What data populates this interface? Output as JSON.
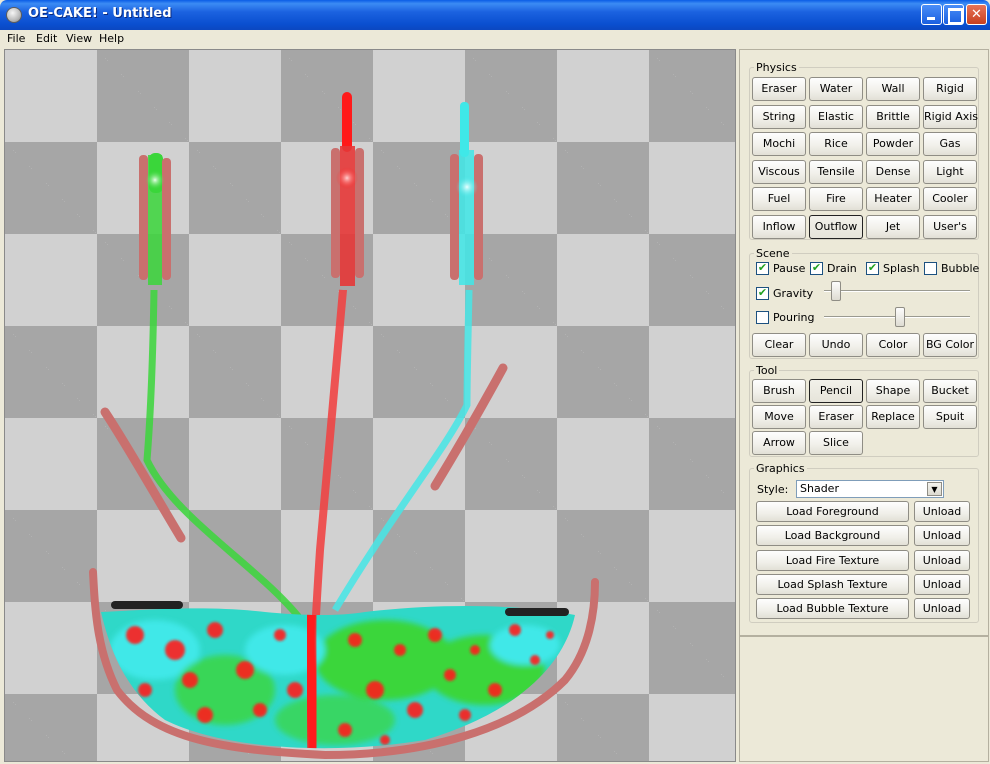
{
  "window": {
    "title": "OE-CAKE! - Untitled"
  },
  "menu": [
    "File",
    "Edit",
    "View",
    "Help"
  ],
  "physics": {
    "label": "Physics",
    "buttons": [
      "Eraser",
      "Water",
      "Wall",
      "Rigid",
      "String",
      "Elastic",
      "Brittle",
      "Rigid Axis",
      "Mochi",
      "Rice",
      "Powder",
      "Gas",
      "Viscous",
      "Tensile",
      "Dense",
      "Light",
      "Fuel",
      "Fire",
      "Heater",
      "Cooler",
      "Inflow",
      "Outflow",
      "Jet",
      "User's"
    ],
    "active": "Outflow"
  },
  "scene": {
    "label": "Scene",
    "checks": [
      {
        "label": "Pause",
        "checked": true
      },
      {
        "label": "Drain",
        "checked": true
      },
      {
        "label": "Splash",
        "checked": true
      },
      {
        "label": "Bubble",
        "checked": false
      }
    ],
    "gravity": {
      "label": "Gravity",
      "checked": true,
      "level": 0.08
    },
    "pouring": {
      "label": "Pouring",
      "checked": false,
      "level": 0.52
    },
    "buttons": [
      "Clear",
      "Undo",
      "Color",
      "BG Color"
    ]
  },
  "tool": {
    "label": "Tool",
    "buttons": [
      "Brush",
      "Pencil",
      "Shape",
      "Bucket",
      "Move",
      "Eraser",
      "Replace",
      "Spuit",
      "Arrow",
      "Slice"
    ],
    "active": "Pencil"
  },
  "graphics": {
    "label": "Graphics",
    "style_label": "Style:",
    "style_value": "Shader",
    "loaders": [
      {
        "load": "Load Foreground",
        "unload": "Unload"
      },
      {
        "load": "Load Background",
        "unload": "Unload"
      },
      {
        "load": "Load Fire Texture",
        "unload": "Unload"
      },
      {
        "load": "Load Splash Texture",
        "unload": "Unload"
      },
      {
        "load": "Load Bubble Texture",
        "unload": "Unload"
      }
    ]
  },
  "colors": {
    "green": "#3bd63b",
    "red": "#ff1a1a",
    "cyan": "#3fe8e8",
    "wall": "#c9706e"
  }
}
